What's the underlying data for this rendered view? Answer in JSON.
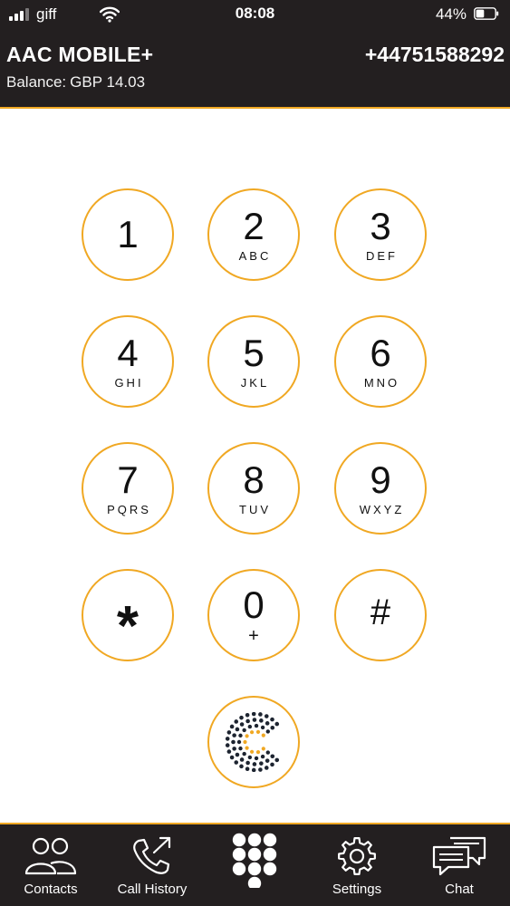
{
  "status_bar": {
    "carrier": "giff",
    "time": "08:08",
    "battery_percent": "44%",
    "battery_level": 0.44
  },
  "header": {
    "app_title": "AAC MOBILE+",
    "phone_number": "+44751588292",
    "balance_label": "Balance:",
    "balance_value": "GBP 14.03"
  },
  "keypad": {
    "keys": [
      {
        "digit": "1",
        "letters": ""
      },
      {
        "digit": "2",
        "letters": "ABC"
      },
      {
        "digit": "3",
        "letters": "DEF"
      },
      {
        "digit": "4",
        "letters": "GHI"
      },
      {
        "digit": "5",
        "letters": "JKL"
      },
      {
        "digit": "6",
        "letters": "MNO"
      },
      {
        "digit": "7",
        "letters": "PQRS"
      },
      {
        "digit": "8",
        "letters": "TUV"
      },
      {
        "digit": "9",
        "letters": "WXYZ"
      },
      {
        "digit": "*",
        "letters": ""
      },
      {
        "digit": "0",
        "letters": "+"
      },
      {
        "digit": "#",
        "letters": ""
      }
    ],
    "call_icon": "aac-logo-icon"
  },
  "tabbar": {
    "tabs": [
      {
        "label": "Contacts",
        "icon": "contacts-icon"
      },
      {
        "label": "Call History",
        "icon": "call-history-icon"
      },
      {
        "label": "",
        "icon": "dialpad-icon"
      },
      {
        "label": "Settings",
        "icon": "gear-icon"
      },
      {
        "label": "Chat",
        "icon": "chat-icon"
      }
    ]
  },
  "colors": {
    "header_bg": "#231f20",
    "accent": "#f0a823",
    "text_dark": "#111111"
  }
}
